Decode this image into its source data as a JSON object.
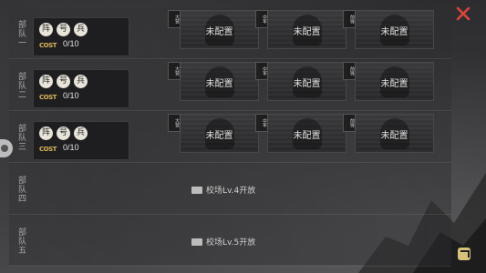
{
  "rows": [
    {
      "label": "部队一",
      "formation": {
        "chips": [
          "阵",
          "号",
          "兵"
        ],
        "cost_icon_text": "COST",
        "cost": "0/10"
      },
      "slots": [
        {
          "tag": "大营",
          "text": "未配置"
        },
        {
          "tag": "中军",
          "text": "未配置"
        },
        {
          "tag": "前锋",
          "text": "未配置"
        }
      ]
    },
    {
      "label": "部队二",
      "formation": {
        "chips": [
          "阵",
          "号",
          "兵"
        ],
        "cost_icon_text": "COST",
        "cost": "0/10"
      },
      "slots": [
        {
          "tag": "大营",
          "text": "未配置"
        },
        {
          "tag": "中军",
          "text": "未配置"
        },
        {
          "tag": "前锋",
          "text": "未配置"
        }
      ]
    },
    {
      "label": "部队三",
      "formation": {
        "chips": [
          "阵",
          "号",
          "兵"
        ],
        "cost_icon_text": "COST",
        "cost": "0/10"
      },
      "slots": [
        {
          "tag": "大营",
          "text": "未配置"
        },
        {
          "tag": "中军",
          "text": "未配置"
        },
        {
          "tag": "前锋",
          "text": "未配置"
        }
      ]
    },
    {
      "label": "部队四",
      "locked_text": "校场Lv.4开放"
    },
    {
      "label": "部队五",
      "locked_text": "校场Lv.5开放"
    }
  ],
  "colors": {
    "close": "#d9453c",
    "accent": "#d8c17a"
  },
  "icons": {
    "close": "close-icon",
    "share": "share-icon",
    "lock": "lock-icon",
    "side": "side-tab-icon"
  }
}
